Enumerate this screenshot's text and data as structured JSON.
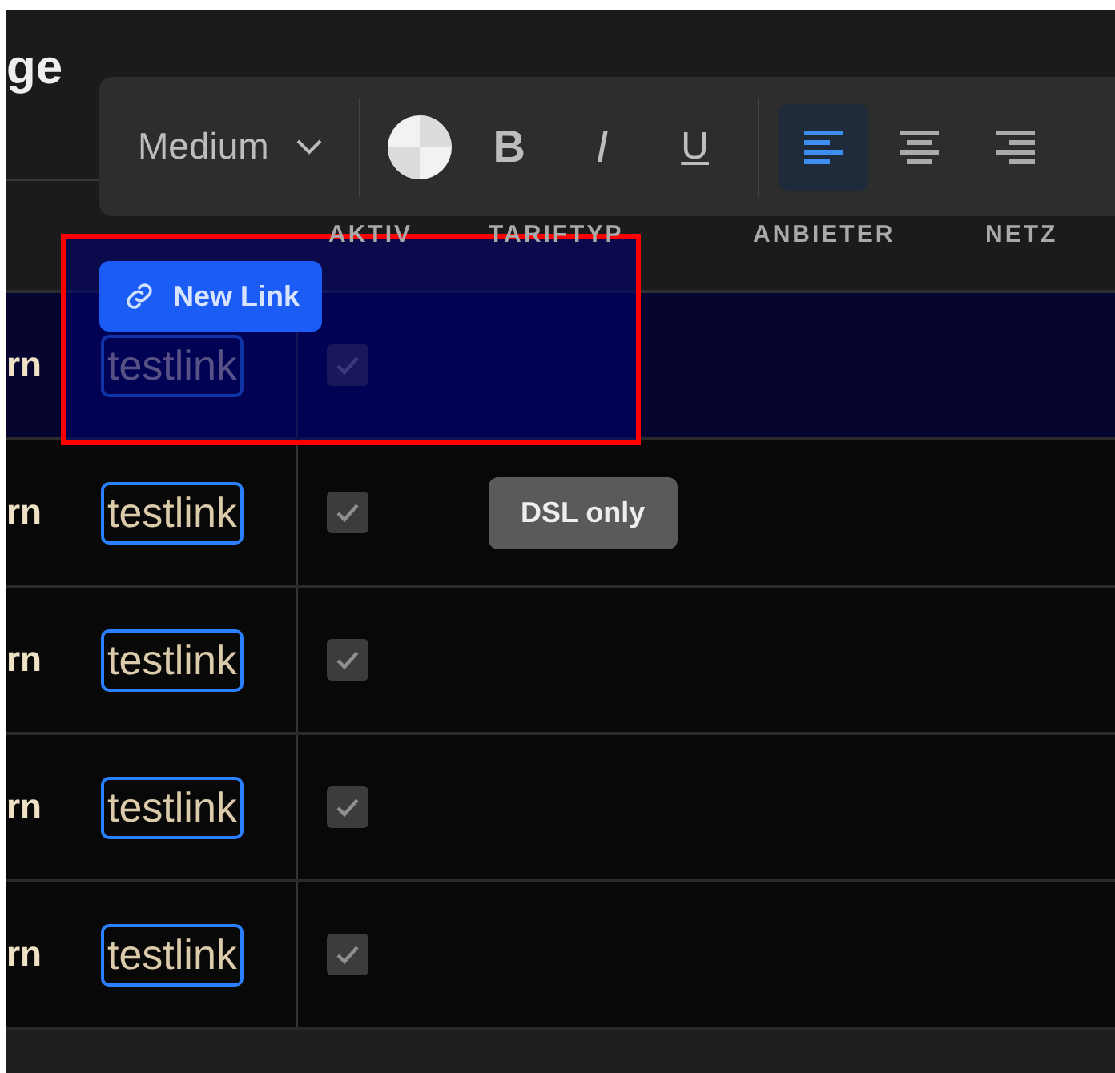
{
  "page": {
    "title": "ge"
  },
  "toolbar": {
    "font_weight": "Medium",
    "bold": "B",
    "italic": "I",
    "underline": "U",
    "alignments": [
      {
        "kind": "left",
        "selected": true
      },
      {
        "kind": "center",
        "selected": false
      },
      {
        "kind": "right",
        "selected": false
      }
    ]
  },
  "table": {
    "columns": [
      "AKTIV",
      "TARIFTYP",
      "ANBIETER",
      "NETZ"
    ],
    "rows": [
      {
        "column_1": "rn",
        "link": "testlink",
        "checked": true,
        "selected": true
      },
      {
        "column_1": "rn",
        "link": "testlink",
        "checked": true,
        "selected": false,
        "tariff": "DSL only"
      },
      {
        "column_1": "rn",
        "link": "testlink",
        "checked": true,
        "selected": false
      },
      {
        "column_1": "rn",
        "link": "testlink",
        "checked": true,
        "selected": false
      },
      {
        "column_1": "rn",
        "link": "testlink",
        "checked": true,
        "selected": false
      }
    ]
  },
  "selection": {
    "button": "New Link"
  }
}
